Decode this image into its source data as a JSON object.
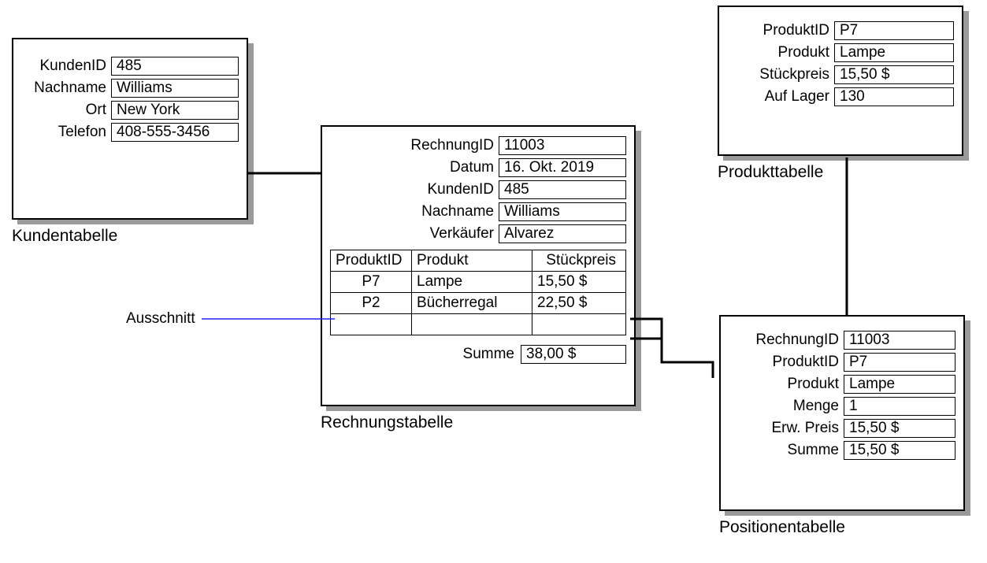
{
  "kunden": {
    "caption": "Kundentabelle",
    "fields": {
      "kundenid_l": "KundenID",
      "kundenid_v": "485",
      "nachname_l": "Nachname",
      "nachname_v": "Williams",
      "ort_l": "Ort",
      "ort_v": "New York",
      "telefon_l": "Telefon",
      "telefon_v": "408-555-3456"
    }
  },
  "rechnung": {
    "caption": "Rechnungstabelle",
    "fields": {
      "rechnungid_l": "RechnungID",
      "rechnungid_v": "11003",
      "datum_l": "Datum",
      "datum_v": "16. Okt. 2019",
      "kundenid_l": "KundenID",
      "kundenid_v": "485",
      "nachname_l": "Nachname",
      "nachname_v": "Williams",
      "verkaeufer_l": "Verkäufer",
      "verkaeufer_v": "Alvarez"
    },
    "sub_headers": {
      "c1": "ProduktID",
      "c2": "Produkt",
      "c3": "Stückpreis"
    },
    "sub_rows": [
      {
        "c1": "P7",
        "c2": "Lampe",
        "c3": "15,50 $"
      },
      {
        "c1": "P2",
        "c2": "Bücherregal",
        "c3": "22,50 $"
      },
      {
        "c1": "",
        "c2": "",
        "c3": ""
      }
    ],
    "summe_l": "Summe",
    "summe_v": "38,00 $"
  },
  "produkt": {
    "caption": "Produkttabelle",
    "fields": {
      "produktid_l": "ProduktID",
      "produktid_v": "P7",
      "produkt_l": "Produkt",
      "produkt_v": "Lampe",
      "stueck_l": "Stückpreis",
      "stueck_v": "15,50 $",
      "lager_l": "Auf Lager",
      "lager_v": "130"
    }
  },
  "position": {
    "caption": "Positionentabelle",
    "fields": {
      "rechnungid_l": "RechnungID",
      "rechnungid_v": "11003",
      "produktid_l": "ProduktID",
      "produktid_v": "P7",
      "produkt_l": "Produkt",
      "produkt_v": "Lampe",
      "menge_l": "Menge",
      "menge_v": "1",
      "erw_l": "Erw. Preis",
      "erw_v": "15,50 $",
      "summe_l": "Summe",
      "summe_v": "15,50 $"
    }
  },
  "ausschnitt_label": "Ausschnitt"
}
